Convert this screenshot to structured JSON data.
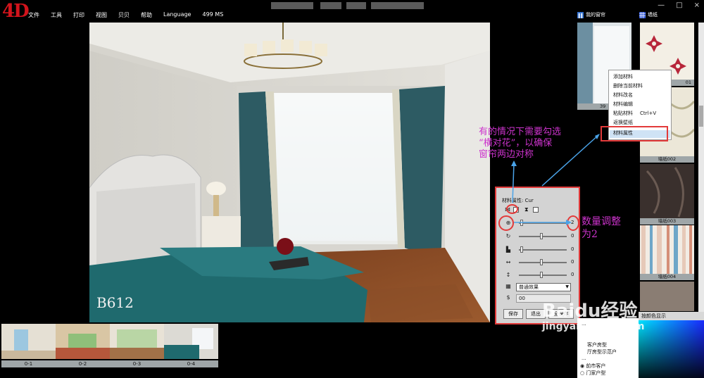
{
  "app": {
    "logo": "4D",
    "menu": [
      "文件",
      "工具",
      "打印",
      "视图",
      "贝贝",
      "帮助",
      "Language",
      "499 MS"
    ],
    "right_menu": [
      "我的窗帘",
      "墙纸"
    ],
    "window_controls": [
      "—",
      "□",
      "×"
    ]
  },
  "scene": {
    "watermark_text": "B612"
  },
  "thumbnails": [
    "0-1",
    "0-2",
    "0-3",
    "0-4"
  ],
  "library": {
    "first_label": "39",
    "swatches": [
      "墙纸002",
      "墙纸003",
      "墙纸004"
    ],
    "partial_label": "01"
  },
  "context_menu": {
    "items": [
      "添加材料",
      "删除当前材料",
      "材料改名",
      "材料编辑",
      "粘贴材料",
      "返换壁纸",
      "材料属性"
    ],
    "shortcut": "Ctrl+V"
  },
  "properties": {
    "title": "材料属性: Cur",
    "rows": [
      {
        "icon": "zoom-icon",
        "value": "2"
      },
      {
        "icon": "rotate-icon",
        "value": "0"
      },
      {
        "icon": "brightness-icon",
        "value": "0"
      },
      {
        "icon": "horizontal-shift-icon",
        "value": "0"
      },
      {
        "icon": "vertical-shift-icon",
        "value": "0"
      }
    ],
    "effect_select": "普通效果",
    "dollar_input": "00",
    "buttons": [
      "保存",
      "退出",
      "全保存"
    ]
  },
  "color_panel": {
    "header": "按颜色显示"
  },
  "bottom_options": {
    "items": [
      "...",
      "客户房型",
      "厅房型示范户",
      "...",
      "前市客户",
      "门家户型"
    ]
  },
  "annotations": {
    "callout_top": [
      "有的情况下需要勾选",
      "“横对花”，以确保",
      "窗帘两边对称"
    ],
    "callout_right": [
      "数量调整",
      "为2"
    ]
  },
  "watermark": {
    "brand": "Baidu经验",
    "url": "jingyan.baidu.com"
  },
  "colors": {
    "accent_red": "#e23a3a",
    "annotation_magenta": "#cc33cc",
    "logo_red": "#d2141c"
  }
}
